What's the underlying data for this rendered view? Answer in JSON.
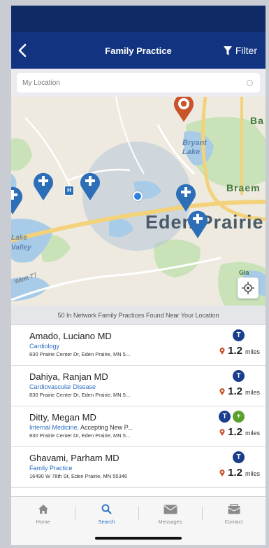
{
  "header": {
    "title": "Family Practice",
    "back_icon": "chevron-left-icon",
    "filter_label": "Filter",
    "filter_icon": "funnel-icon"
  },
  "search": {
    "placeholder": "My Location",
    "location_icon": "crosshair-icon"
  },
  "map": {
    "labels": {
      "city": "Eden Prairie",
      "lake": "Bryant Lake",
      "braemar": "Braem",
      "edge_left_top": "Lake",
      "edge_left_bottom": "Valley",
      "road_fragment": "Weet 77",
      "top_right_fragment": "Ba",
      "bottom_right_fragment": "Gla"
    },
    "colors": {
      "pin_network": "#2c6fb8",
      "pin_selected": "#c9532b",
      "user_dot": "#2f7fe0",
      "water": "#a8cbe8",
      "park": "#c9e2b8",
      "highway": "#f2d27a"
    }
  },
  "summary_text": "50 In Network Family Practices Found Near Your Location",
  "results": [
    {
      "name": "Amado, Luciano MD",
      "specialty": "Cardiology",
      "specialty_extra": "",
      "address": "830 Prairie Center Dr, Eden Prairie, MN 5...",
      "distance": "1.2",
      "unit": "miles",
      "badges": [
        "T"
      ]
    },
    {
      "name": "Dahiya, Ranjan MD",
      "specialty": "Cardiovascular Disease",
      "specialty_extra": "",
      "address": "830 Prairie Center Dr, Eden Prairie, MN 5...",
      "distance": "1.2",
      "unit": "miles",
      "badges": [
        "T"
      ]
    },
    {
      "name": "Ditty, Megan MD",
      "specialty": "Internal Medicine,",
      "specialty_extra": " Accepting New P...",
      "address": "830 Prairie Center Dr, Eden Prairie, MN 5...",
      "distance": "1.2",
      "unit": "miles",
      "badges": [
        "T",
        "+"
      ]
    },
    {
      "name": "Ghavami, Parham MD",
      "specialty": "Family Practice",
      "specialty_extra": "",
      "address": "16490 W 78th St, Eden Prairie, MN 55346",
      "distance": "1.2",
      "unit": "miles",
      "badges": [
        "T"
      ]
    }
  ],
  "tabs": [
    {
      "label": "Home",
      "icon": "home-icon",
      "active": false
    },
    {
      "label": "Search",
      "icon": "search-icon",
      "active": true
    },
    {
      "label": "Messages",
      "icon": "envelope-icon",
      "active": false
    },
    {
      "label": "Contact",
      "icon": "contact-icon",
      "active": false
    }
  ]
}
